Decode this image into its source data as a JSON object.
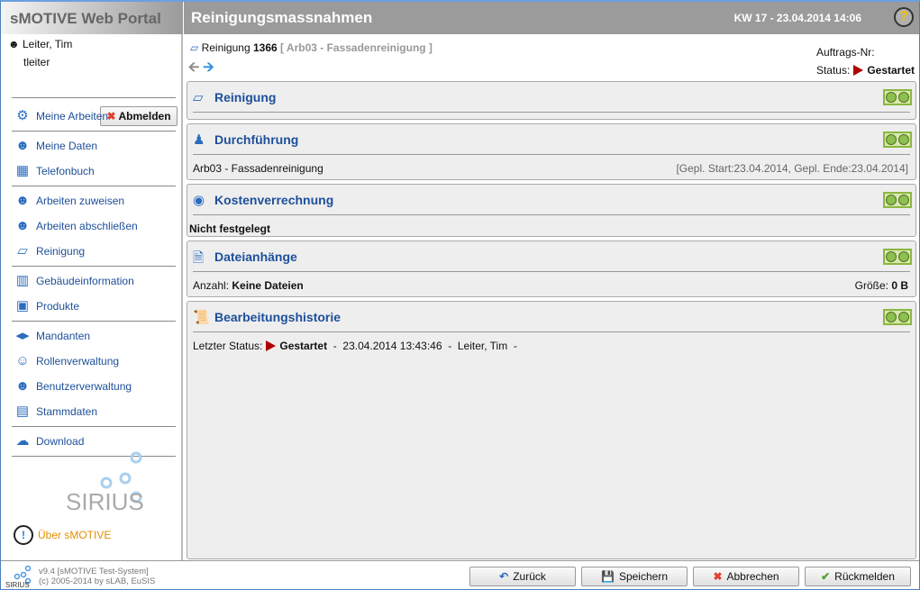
{
  "header": {
    "app_title": "sMOTIVE Web Portal",
    "page_title": "Reinigungsmassnahmen",
    "date": "KW 17 - 23.04.2014 14:06",
    "help": "?"
  },
  "user": {
    "name": "Leiter, Tim",
    "login": "tleiter",
    "logout": "Abmelden"
  },
  "sidebar": {
    "items": [
      {
        "label": "Meine Arbeiten",
        "icon": "gears-icon"
      },
      {
        "label": "Meine Daten",
        "icon": "user-icon"
      },
      {
        "label": "Telefonbuch",
        "icon": "phonebook-icon"
      },
      {
        "label": "Arbeiten zuweisen",
        "icon": "worker-assign-icon"
      },
      {
        "label": "Arbeiten abschließen",
        "icon": "worker-complete-icon"
      },
      {
        "label": "Reinigung",
        "icon": "cleaning-icon"
      },
      {
        "label": "Gebäudeinformation",
        "icon": "building-icon"
      },
      {
        "label": "Produkte",
        "icon": "products-icon"
      },
      {
        "label": "Mandanten",
        "icon": "clients-icon"
      },
      {
        "label": "Rollenverwaltung",
        "icon": "roles-icon"
      },
      {
        "label": "Benutzerverwaltung",
        "icon": "users-icon"
      },
      {
        "label": "Stammdaten",
        "icon": "master-data-icon"
      },
      {
        "label": "Download",
        "icon": "download-icon"
      }
    ],
    "logo_text": "SIRIUS",
    "about": "Über sMOTIVE"
  },
  "record": {
    "type": "Reinigung",
    "number": "1366",
    "subtitle": "[ Arb03 - Fassadenreinigung ]",
    "order_label": "Auftrags-Nr:",
    "status_label": "Status:",
    "status": "Gestartet"
  },
  "panels": {
    "reinigung": {
      "title": "Reinigung"
    },
    "durchfuehrung": {
      "title": "Durchführung",
      "text": "Arb03 - Fassadenreinigung",
      "dates": "[Gepl. Start:23.04.2014, Gepl. Ende:23.04.2014]"
    },
    "kosten": {
      "title": "Kostenverrechnung",
      "text": "Nicht festgelegt"
    },
    "dateien": {
      "title": "Dateianhänge",
      "count_label": "Anzahl:",
      "count": "Keine Dateien",
      "size_label": "Größe:",
      "size": "0 B"
    },
    "historie": {
      "title": "Bearbeitungshistorie",
      "label": "Letzter Status:",
      "status": "Gestartet",
      "sep1": "-",
      "date": "23.04.2014 13:43:46",
      "sep2": "-",
      "user": "Leiter, Tim",
      "sep3": "-"
    }
  },
  "footer": {
    "version": "v9.4 [sMOTIVE Test-System]",
    "copyright": "(c) 2005-2014 by sLAB, EuSIS",
    "buttons": {
      "back": "Zurück",
      "save": "Speichern",
      "cancel": "Abbrechen",
      "report": "Rückmelden"
    }
  },
  "colors": {
    "accent": "#1d4f9a",
    "status": "#b00000",
    "about": "#e09000"
  }
}
